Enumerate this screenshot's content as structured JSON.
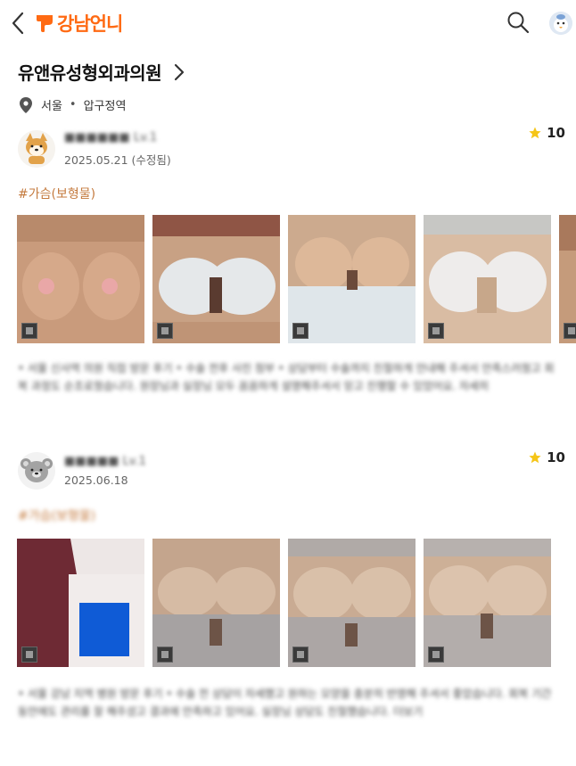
{
  "header": {
    "brand": "강남언니",
    "brand_color": "#ff6a13",
    "icons": [
      "back-arrow-icon",
      "search-icon",
      "profile-avatar-icon"
    ]
  },
  "hospital": {
    "name": "유앤유성형외과의원",
    "region": "서울",
    "district": "압구정역"
  },
  "reviews": [
    {
      "nickname": "■■■■■■ Lv.1",
      "date": "2025.05.21 (수정됨)",
      "rating": "10",
      "tag": "#가슴(보형물)",
      "body": "• 서울 신사역 의원 직접 방문 후기 • 수술 전후 사진 첨부 • 상담부터 수술까지 친절하게 안내해 주셔서 만족스러웠고 회복 과정도 순조로웠습니다. 원장님과 실장님 모두 꼼꼼하게 설명해주셔서 믿고 진행할 수 있었어요. 자세히"
    },
    {
      "nickname": "■■■■■ Lv.1",
      "date": "2025.06.18",
      "rating": "10",
      "tag": "#가슴(보형물)",
      "body": "• 서울 강남 지역 병원 방문 후기 • 수술 전 상담이 자세했고 원하는 모양을 충분히 반영해 주셔서 좋았습니다. 회복 기간 동안에도 관리를 잘 해주셨고 결과에 만족하고 있어요. 실장님 상담도 친절했습니다. 더보기"
    }
  ]
}
